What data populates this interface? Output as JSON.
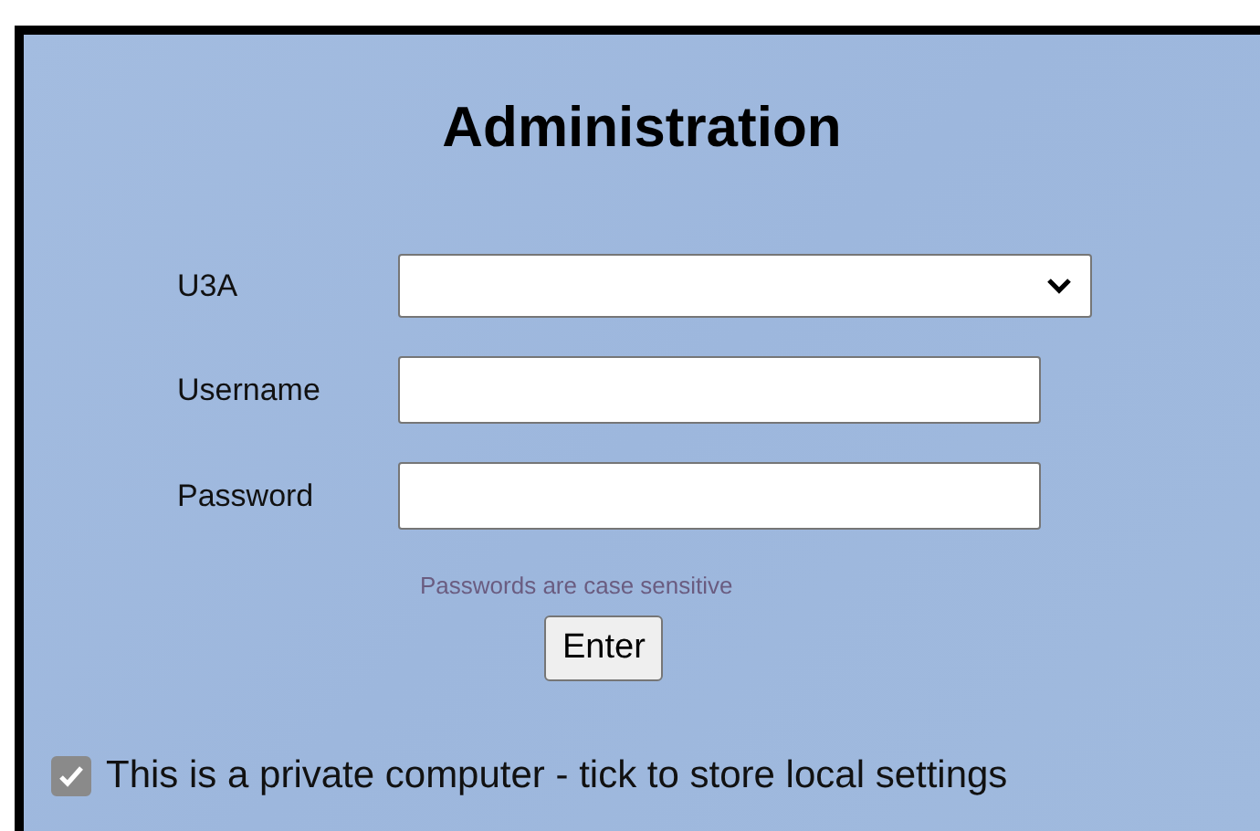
{
  "title": "Administration",
  "fields": [
    {
      "kind": "select",
      "label": "U3A"
    },
    {
      "kind": "text",
      "label": "Username"
    },
    {
      "kind": "password",
      "label": "Password"
    }
  ],
  "hint": "Passwords are case sensitive",
  "submit": "Enter",
  "private": {
    "label": "This is a private computer - tick to store local settings",
    "checked": true
  }
}
